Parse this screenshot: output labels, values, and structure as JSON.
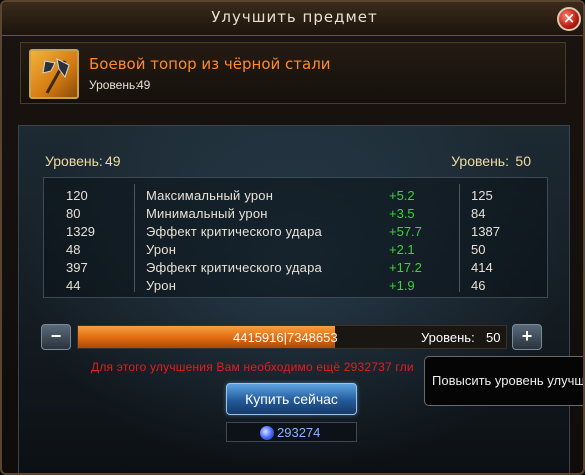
{
  "window": {
    "title": "Улучшить предмет",
    "close_label": "×"
  },
  "item": {
    "name": "Боевой топор из чёрной стали",
    "level_label": "Уровень:",
    "level_value": "49",
    "icon": "battle-axe-icon"
  },
  "upgrade": {
    "current_level_label": "Уровень:",
    "current_level_value": "49",
    "next_level_label": "Уровень:",
    "next_level_value": "50",
    "stats": [
      {
        "old": "120",
        "name": "Максимальный урон",
        "delta": "+5.2",
        "new": "125"
      },
      {
        "old": "80",
        "name": "Минимальный урон",
        "delta": "+3.5",
        "new": "84"
      },
      {
        "old": "1329",
        "name": "Эффект критического удара",
        "delta": "+57.7",
        "new": "1387"
      },
      {
        "old": "48",
        "name": "Урон",
        "delta": "+2.1",
        "new": "50"
      },
      {
        "old": "397",
        "name": "Эффект критического удара",
        "delta": "+17.2",
        "new": "414"
      },
      {
        "old": "44",
        "name": "Урон",
        "delta": "+1.9",
        "new": "46"
      }
    ]
  },
  "progress": {
    "text": "4415916|7348653",
    "current": 4415916,
    "max": 7348653,
    "level_label": "Уровень:",
    "level_value": "50",
    "minus_label": "−",
    "plus_label": "+"
  },
  "warning": "Для этого улучшения Вам необходимо ещё 2932737 гли",
  "buy_button": "Купить сейчас",
  "cost": {
    "value": "293274",
    "icon": "gem-icon"
  },
  "tooltip": "Повысить уровень улучш",
  "colors": {
    "accent_orange": "#ff8a2a",
    "stat_delta_green": "#3fd23a",
    "warning_red": "#e41d1d",
    "level_gold": "#f0dca0"
  }
}
